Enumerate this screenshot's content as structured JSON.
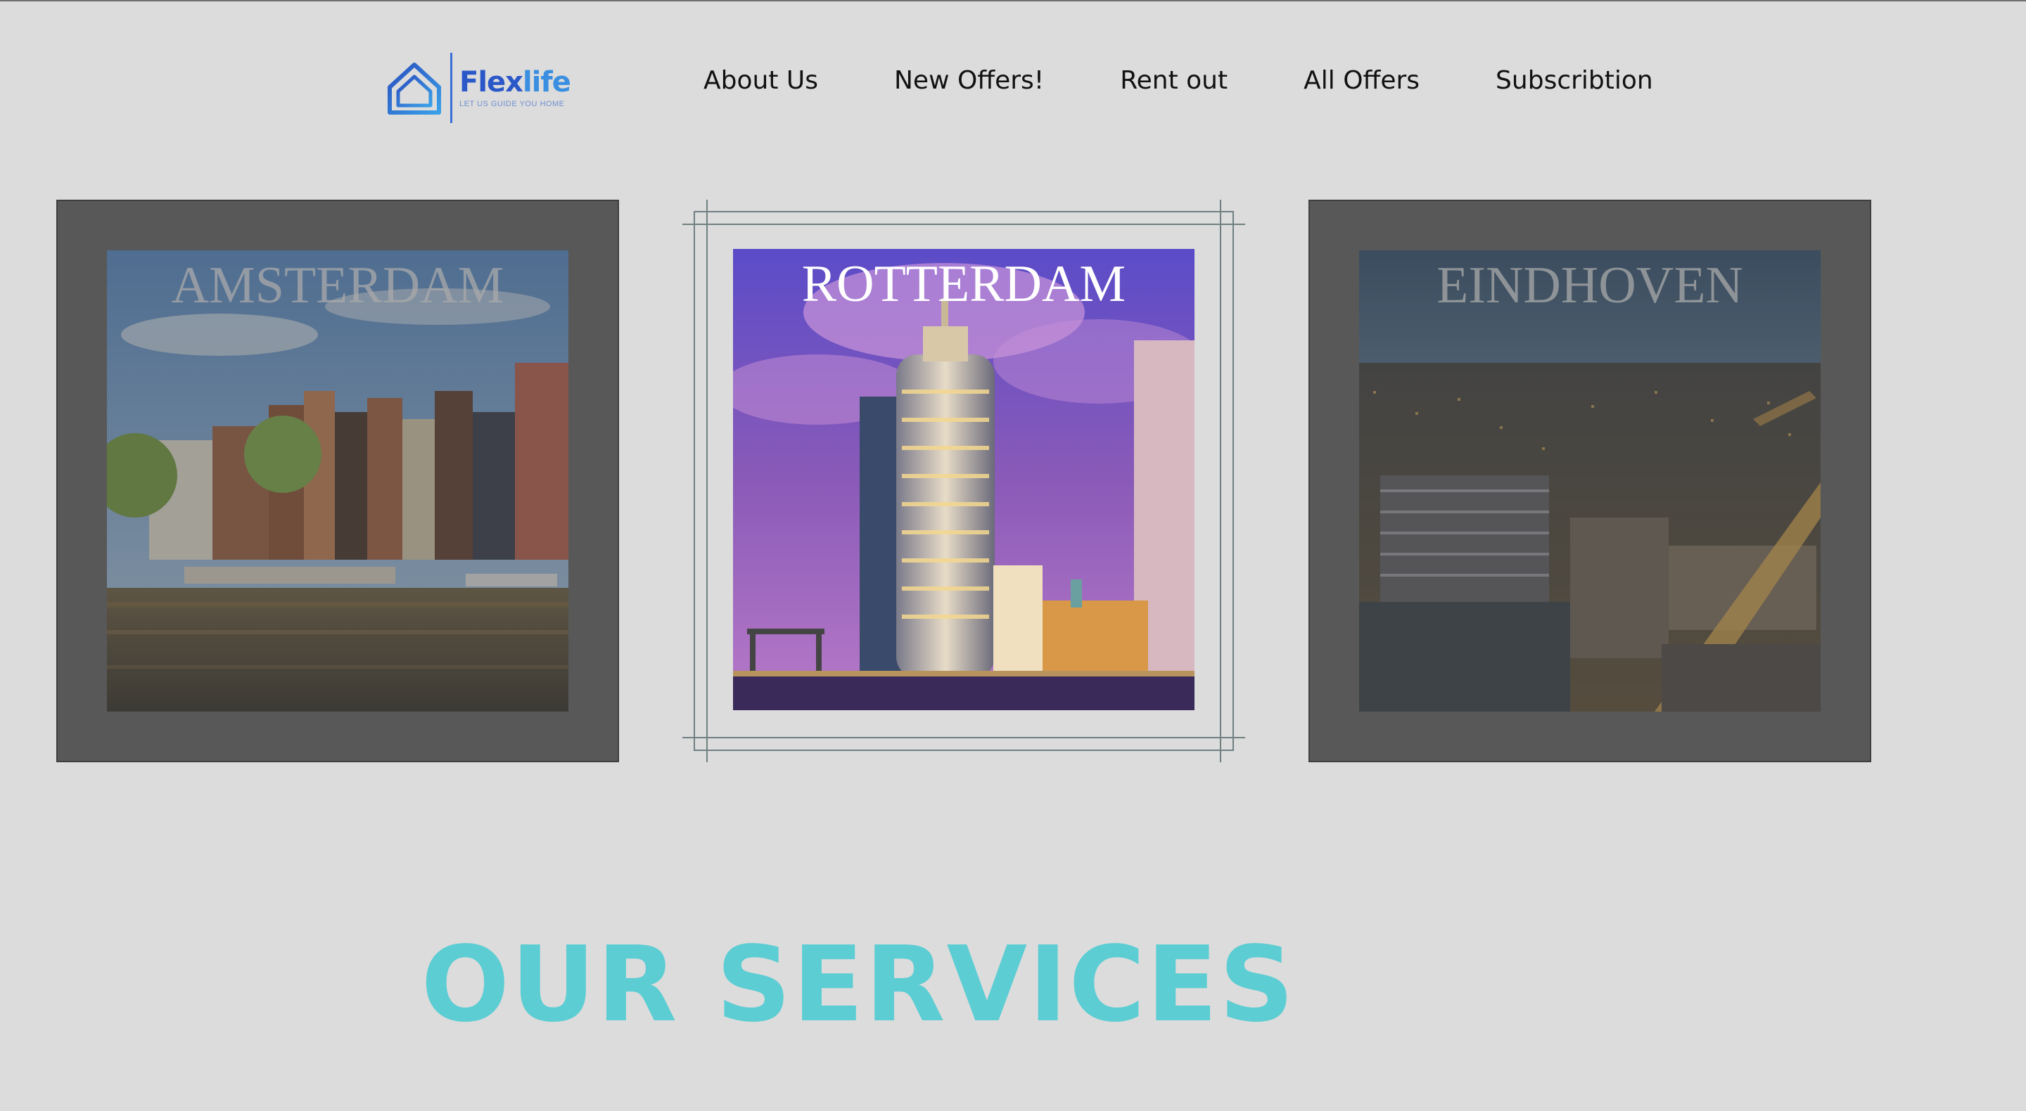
{
  "header": {
    "logo": {
      "name_part1": "Flex",
      "name_part2": "life",
      "tagline": "LET US GUIDE YOU HOME",
      "icon": "house-icon"
    },
    "nav": [
      {
        "label": "About Us"
      },
      {
        "label": "New Offers!"
      },
      {
        "label": "Rent out"
      },
      {
        "label": "All Offers"
      },
      {
        "label": "Subscribtion"
      }
    ]
  },
  "cities": [
    {
      "name": "AMSTERDAM",
      "state": "dimmed"
    },
    {
      "name": "ROTTERDAM",
      "state": "active"
    },
    {
      "name": "EINDHOVEN",
      "state": "dimmed"
    }
  ],
  "services": {
    "title": "OUR SERVICES"
  },
  "colors": {
    "background": "#dcdcdc",
    "brand_blue": "#2b58c8",
    "services_teal": "#5ccdd3",
    "card_dim": "#585858"
  }
}
